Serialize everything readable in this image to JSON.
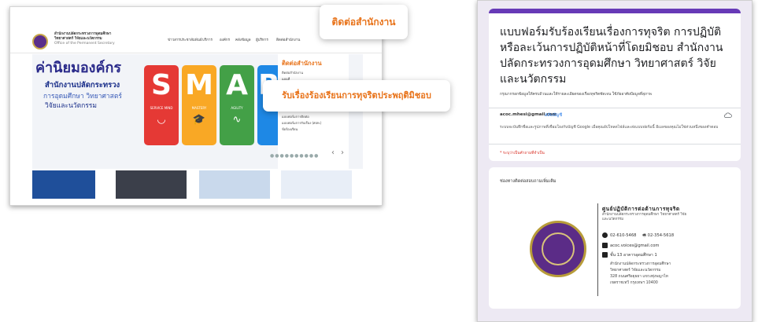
{
  "left_site": {
    "org_name_line1": "สำนักงานปลัดกระทรวงการอุดมศึกษา",
    "org_name_line2": "วิทยาศาสตร์ วิจัยและนวัตกรรม",
    "org_name_line3": "Office of the Permanent Secretary",
    "nav": [
      "ข่าวสารประชาสัมพันธ์",
      "บริการ",
      "องค์กร",
      "คลังข้อมูล",
      "ผู้บริหาร",
      "ติดต่อสำนักงาน"
    ],
    "banner": {
      "title": "ค่านิยมองค์กร",
      "sub1": "สำนักงานปลัดกระทรวง",
      "sub2": "การอุดมศึกษา วิทยาศาสตร์",
      "sub3": "วิจัยและนวัตกรรม"
    },
    "cards": [
      {
        "letter": "S",
        "caption": "SERVICE MIND",
        "color": "#e53935",
        "symbol": "◡"
      },
      {
        "letter": "M",
        "caption": "MASTERY",
        "color": "#f9a825",
        "symbol": "🎓"
      },
      {
        "letter": "A",
        "caption": "AGILITY",
        "color": "#43a047",
        "symbol": "∿"
      },
      {
        "letter": "R",
        "caption": "RE",
        "color": "#1e88e5",
        "symbol": ""
      }
    ],
    "menu": {
      "heading": "ติดต่อสำนักงาน",
      "items": [
        "ติดต่อสำนักงาน",
        "แผนที่",
        "รับเรื่องร้องเรียน",
        "",
        "แบบฟอร์มการติดต่อ",
        "แบบฟอร์มการรับเรื่อง (ศปท.)",
        "ข้อร้องเรียน"
      ]
    },
    "dots": "●●●●●●●●●●",
    "prev": "‹",
    "next": "›"
  },
  "callouts": {
    "contact": "ติดต่อสำนักงาน",
    "complaint": "รับเรื่องร้องเรียนการทุจริตประพฤติมิชอบ"
  },
  "form": {
    "title": "แบบฟอร์มรับร้องเรียนเรื่องการทุจริต การปฏิบัติหรือละเว้นการปฏิบัติหน้าที่โดยมิชอบ สำนักงานปลัดกระทรวงการอุดมศึกษา วิทยาศาสตร์ วิจัยและนวัตกรรม",
    "description": "กรุณากรอกข้อมูลให้ครบถ้วนและให้รายละเอียดของเรื่องทุจริตชัดเจน ใช้ภัยอาศัยป้อมูลที่สุภาพ",
    "email": "acoc.mhesi@gmail.com",
    "switch_account": "สลับบัญชี",
    "note": "ระบบจะบันทึกชื่อและรูปภาพที่เชื่อมโยงกับบัญชี Google เมื่อคุณอัปโหลดไฟล์และส่งแบบฟอร์มนี้ อีเมลของคุณไม่ใช่ส่วนหนึ่งของคำตอบ",
    "required": "* ระบุว่าเป็นคำถามที่จำเป็น",
    "contact_label": "ช่องทางติดต่อสอบถามเพิ่มเติม"
  },
  "contact": {
    "title": "ศูนย์ปฏิบัติการต่อต้านการทุจริต",
    "subtitle": "สำนักงานปลัดกระทรวงการอุดมศึกษา วิทยาศาสตร์ วิจัยและนวัตกรรม",
    "phone": "02-610-5468",
    "fax": "02-354-5618",
    "email": "acoc.voices@gmail.com",
    "address": [
      "ชั้น 13 อาคารอุดมศึกษา 1",
      "สำนักงานปลัดกระทรวงการอุดมศึกษา",
      "วิทยาศาสตร์ วิจัยและนวัตกรรม",
      "328 ถนนศรีอยุธยา แขวงทุ่งพญาไท",
      "เขตราชเทวี กรุงเทพฯ 10400"
    ]
  }
}
